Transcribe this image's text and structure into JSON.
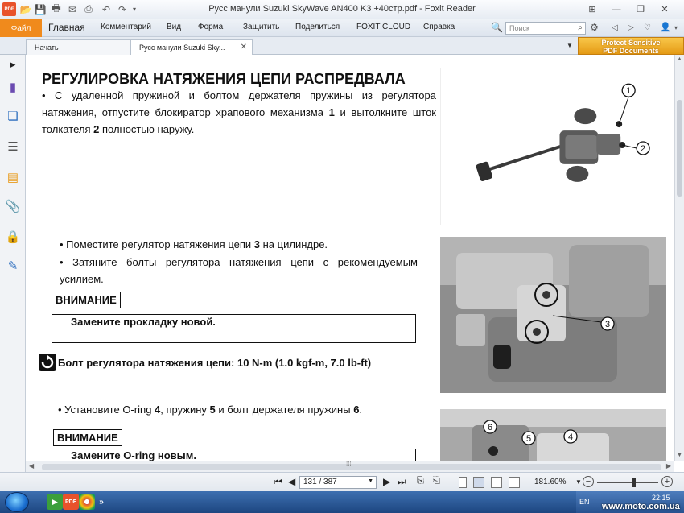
{
  "window": {
    "title": "Русс манули Suzuki SkyWave AN400 K3 +40стр.pdf - Foxit Reader"
  },
  "ribbon": {
    "tabs": [
      "Файл",
      "Главная",
      "Комментарий",
      "Вид",
      "Форма",
      "Защитить",
      "Поделиться",
      "FOXIT CLOUD",
      "Справка"
    ],
    "search_placeholder": "Поиск"
  },
  "doc_tabs": [
    "Начать",
    "Русс манули Suzuki Sky..."
  ],
  "promo": {
    "line1": "Protect Sensitive",
    "line2": "PDF Documents"
  },
  "page": {
    "heading": "РЕГУЛИРОВКА НАТЯЖЕНИЯ ЦЕПИ РАСПРЕДВАЛА",
    "para1": {
      "t1": "• С удаленной пружиной и болтом держателя пружины из регулятора натяжения, отпустите блокиратор храпового механизма ",
      "n1": "1",
      "t2": " и вытолкните шток толкателя ",
      "n2": "2",
      "t3": " полностью наружу."
    },
    "bullet2": {
      "t1": "• Поместите регулятор натяжения цепи ",
      "n1": "3",
      "t2": " на цилиндре."
    },
    "bullet3": "• Затяните болты регулятора натяжения цепи с рекомендуемым усилием.",
    "caution1": {
      "label": "ВНИМАНИЕ",
      "text": "Замените прокладку новой."
    },
    "torque": "Болт регулятора натяжения цепи: 10 N-m (1.0 kgf-m, 7.0 lb-ft)",
    "bullet4": {
      "t1": "• Установите O-ring ",
      "n1": "4",
      "t2": ", пружину ",
      "n2": "5",
      "t3": " и болт держателя пружины ",
      "n3": "6",
      "t4": "."
    },
    "caution2": {
      "label": "ВНИМАНИЕ",
      "text": "Замените O-ring новым."
    },
    "callouts": [
      "1",
      "2",
      "3",
      "4",
      "5",
      "6"
    ]
  },
  "status": {
    "page_indicator": "131 / 387",
    "zoom": "181.60%"
  },
  "taskbar": {
    "lang": "EN",
    "clock": "22:15",
    "watermark": "www.moto.com.ua"
  },
  "colors": {
    "file_tab": "#f08a1c",
    "promo": "#e49a14",
    "taskbar": "#2a5a9c"
  }
}
